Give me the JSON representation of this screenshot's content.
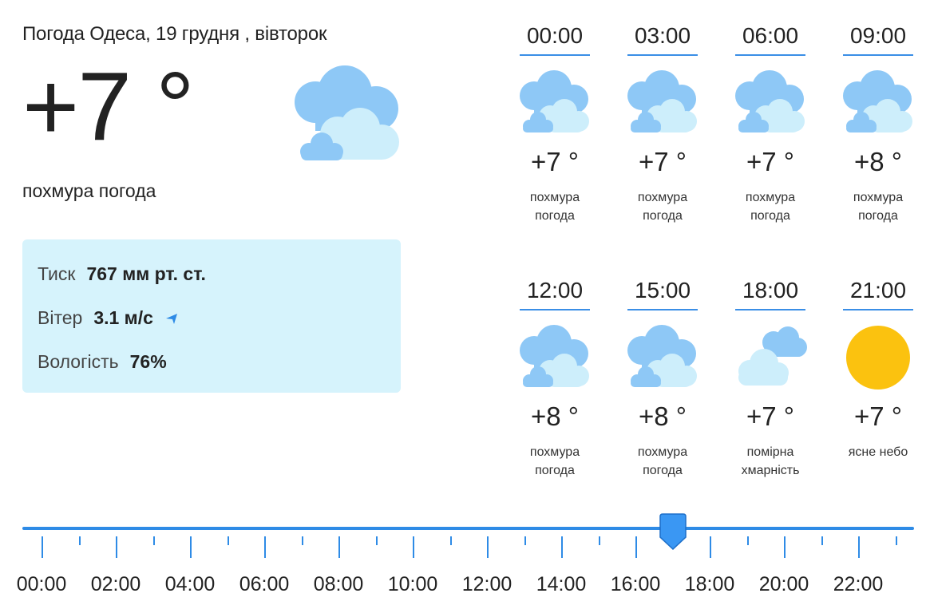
{
  "header": {
    "title": "Погода Одеса, 19 грудня , вівторок"
  },
  "current": {
    "temperature": "+7 °",
    "condition": "похмура погода",
    "icon": "cloudy-icon"
  },
  "details": {
    "pressure_label": "Тиск",
    "pressure_value": "767 мм рт. ст.",
    "wind_label": "Вітер",
    "wind_value": "3.1 м/с",
    "wind_icon": "wind-direction-arrow-icon",
    "humidity_label": "Вологість",
    "humidity_value": "76%"
  },
  "hourly": [
    {
      "time": "00:00",
      "temp": "+7 °",
      "cond1": "похмура",
      "cond2": "погода",
      "icon": "overcast-icon"
    },
    {
      "time": "03:00",
      "temp": "+7 °",
      "cond1": "похмура",
      "cond2": "погода",
      "icon": "overcast-icon"
    },
    {
      "time": "06:00",
      "temp": "+7 °",
      "cond1": "похмура",
      "cond2": "погода",
      "icon": "overcast-icon"
    },
    {
      "time": "09:00",
      "temp": "+8 °",
      "cond1": "похмура",
      "cond2": "погода",
      "icon": "overcast-icon"
    },
    {
      "time": "12:00",
      "temp": "+8 °",
      "cond1": "похмура",
      "cond2": "погода",
      "icon": "overcast-icon"
    },
    {
      "time": "15:00",
      "temp": "+8 °",
      "cond1": "похмура",
      "cond2": "погода",
      "icon": "overcast-icon"
    },
    {
      "time": "18:00",
      "temp": "+7 °",
      "cond1": "помірна",
      "cond2": "хмарність",
      "icon": "partly-cloudy-icon"
    },
    {
      "time": "21:00",
      "temp": "+7 °",
      "cond1": "ясне небо",
      "cond2": "",
      "icon": "sun-icon"
    }
  ],
  "timeline": {
    "labels": [
      "00:00",
      "02:00",
      "04:00",
      "06:00",
      "08:00",
      "10:00",
      "12:00",
      "14:00",
      "16:00",
      "18:00",
      "20:00",
      "22:00"
    ],
    "selected_hour": 17,
    "colors": {
      "accent": "#2e8be6",
      "thumb": "#3a97f3"
    }
  },
  "colors": {
    "panel_bg": "#d6f3fc",
    "cloud_dark": "#8ec8f6",
    "cloud_light": "#cdeefb",
    "sun": "#fbc20f"
  }
}
